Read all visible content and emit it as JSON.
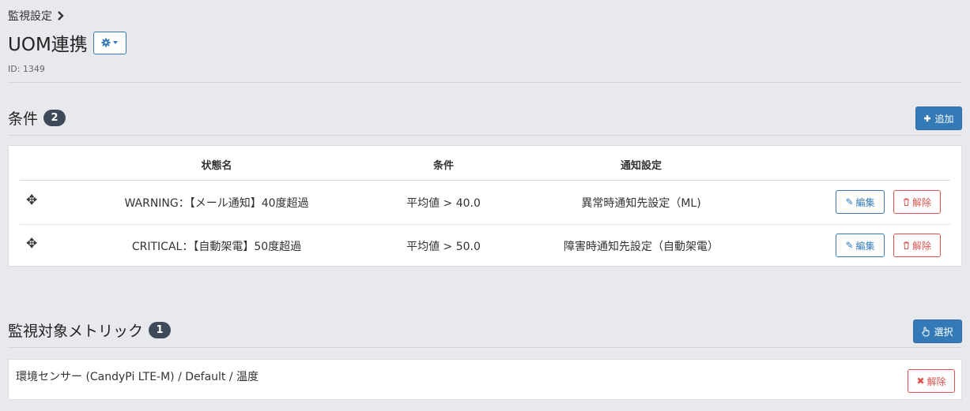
{
  "breadcrumb": {
    "label": "監視設定",
    "chevron": "›"
  },
  "page": {
    "title": "UOM連携",
    "id_text": "ID: 1349"
  },
  "conditions": {
    "title": "条件",
    "count": "2",
    "add_label": "追加",
    "headers": [
      "状態名",
      "条件",
      "通知設定"
    ],
    "rows": [
      {
        "state": "WARNING：【メール通知】40度超過",
        "condition": "平均値 > 40.0",
        "notify": "異常時通知先設定（ML)",
        "edit": "編集",
        "delete": "解除"
      },
      {
        "state": "CRITICAL：【自動架電】50度超過",
        "condition": "平均値 > 50.0",
        "notify": "障害時通知先設定（自動架電）",
        "edit": "編集",
        "delete": "解除"
      }
    ]
  },
  "metrics": {
    "title": "監視対象メトリック",
    "count": "1",
    "select_label": "選択",
    "items": [
      {
        "label": "環境センサー (CandyPi LTE-M) / Default / 温度",
        "delete": "解除"
      }
    ]
  },
  "colors": {
    "primary": "#337ab7",
    "danger": "#d9534f",
    "badge": "#3e4a5a",
    "background": "#e8e9ed"
  }
}
